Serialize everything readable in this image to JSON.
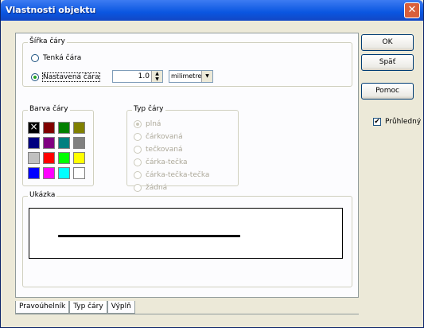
{
  "window": {
    "title": "Vlastnosti objektu",
    "close_glyph": "✕"
  },
  "width_group": {
    "title": "Šířka čáry",
    "radio_thin": "Tenká čára",
    "radio_custom": "Nastavená čára",
    "value": "1.0",
    "unit": "milimetre"
  },
  "color_group": {
    "title": "Barva čáry",
    "swatches": [
      "#000000",
      "#800000",
      "#008000",
      "#808000",
      "#000080",
      "#800080",
      "#008080",
      "#808080",
      "#c0c0c0",
      "#ff0000",
      "#00ff00",
      "#ffff00",
      "#0000ff",
      "#ff00ff",
      "#00ffff",
      "#ffffff"
    ],
    "selected": "#000000"
  },
  "type_group": {
    "title": "Typ čáry",
    "options": [
      "plná",
      "čárkovaná",
      "tečkovaná",
      "čárka-tečka",
      "čárka-tečka-tečka",
      "žádná"
    ],
    "selected": "plná"
  },
  "preview": {
    "title": "Ukázka"
  },
  "tabs": [
    "Pravoúhelník",
    "Typ čáry",
    "Výplň"
  ],
  "active_tab": "Typ čáry",
  "buttons": {
    "ok": "OK",
    "undo": "Späť",
    "help": "Pomoc"
  },
  "transparent": {
    "label": "Průhledný",
    "checked": true,
    "check_glyph": "✔"
  }
}
